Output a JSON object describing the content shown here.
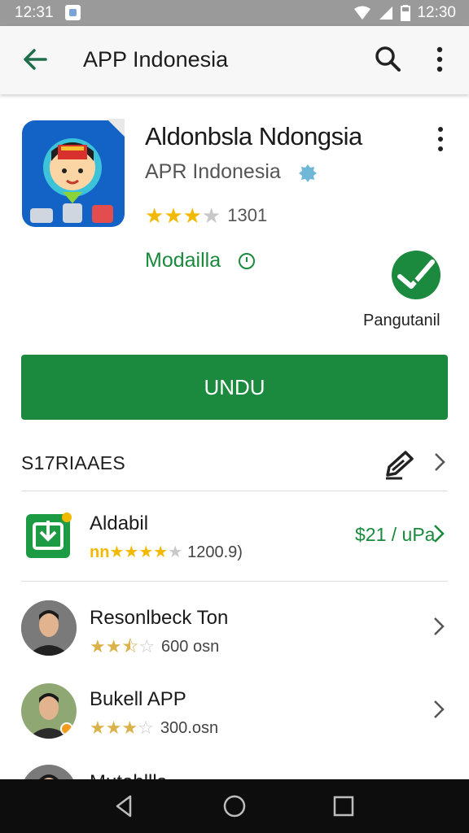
{
  "status_bar": {
    "time_left": "12:31",
    "time_right": "12:30"
  },
  "app_bar": {
    "title": "APP Indonesia"
  },
  "app": {
    "name": "Aldonbsla Ndongsia",
    "developer": "APR Indonesia",
    "rating_count": "1301",
    "rating": 3,
    "status": "Modailla",
    "side_label": "Pangutanil",
    "install_label": "UNDU"
  },
  "section": {
    "title": "S17RIAAES"
  },
  "list": [
    {
      "name": "Aldabil",
      "prefix": "nn",
      "rating": 4,
      "meta": "1200.9)",
      "price": "$21 / uPa"
    },
    {
      "name": "Resonlbeck Ton",
      "rating": 2.5,
      "meta": "600 osn"
    },
    {
      "name": "Bukell APP",
      "rating": 3,
      "meta": "300.osn"
    },
    {
      "name": "Mutohllls"
    }
  ],
  "colors": {
    "accent_green": "#1c8a3e",
    "star_gold": "#f2b900",
    "star_gray": "#c8c8c8"
  }
}
